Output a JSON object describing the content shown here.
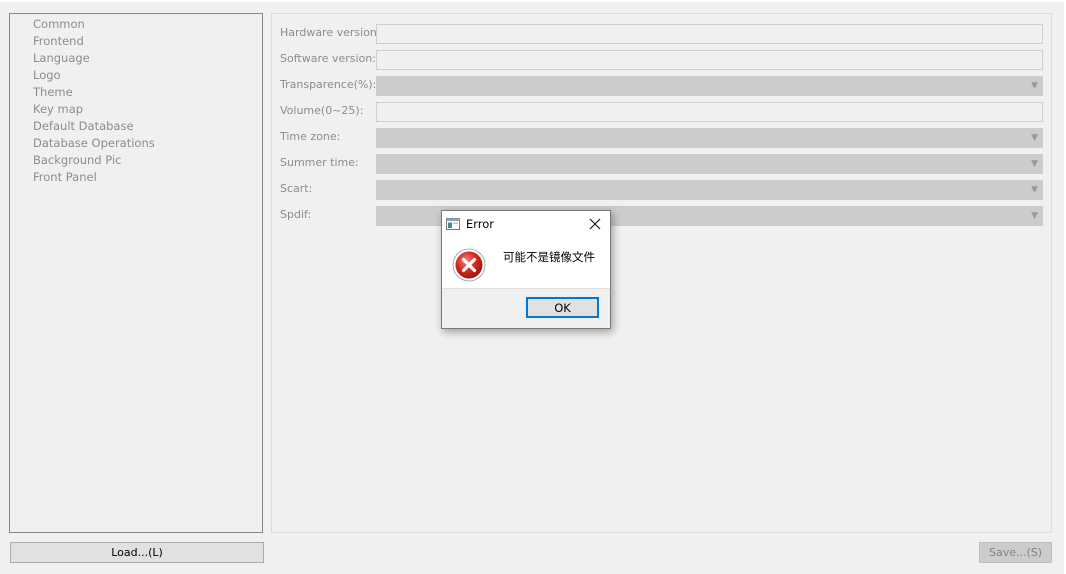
{
  "sidebar": {
    "items": [
      {
        "label": "Common"
      },
      {
        "label": "Frontend"
      },
      {
        "label": "Language"
      },
      {
        "label": "Logo"
      },
      {
        "label": "Theme"
      },
      {
        "label": "Key map"
      },
      {
        "label": "Default Database"
      },
      {
        "label": "Database Operations"
      },
      {
        "label": "Background Pic"
      },
      {
        "label": "Front Panel"
      }
    ]
  },
  "settings": {
    "hardware_version": {
      "label": "Hardware version:",
      "value": ""
    },
    "software_version": {
      "label": "Software version:",
      "value": ""
    },
    "transparence": {
      "label": "Transparence(%):",
      "value": ""
    },
    "volume": {
      "label": "Volume(0~25):",
      "value": ""
    },
    "time_zone": {
      "label": "Time zone:",
      "value": ""
    },
    "summer_time": {
      "label": "Summer time:",
      "value": ""
    },
    "scart": {
      "label": "Scart:",
      "value": ""
    },
    "spdif": {
      "label": "Spdif:",
      "value": ""
    }
  },
  "buttons": {
    "load_label": "Load...(L)",
    "save_label": "Save...(S)"
  },
  "dialog": {
    "title": "Error",
    "message": "可能不是镜像文件",
    "ok_label": "OK"
  },
  "colors": {
    "window_bg": "#f0f0f0",
    "disabled_text": "#8c8c8c",
    "error_red": "#c42b1c",
    "focus_blue": "#0078d7"
  },
  "icons": {
    "dialog_app": "app-window-icon",
    "dialog_close": "close-icon",
    "dialog_error": "error-icon",
    "dropdown": "chevron-down-icon"
  }
}
